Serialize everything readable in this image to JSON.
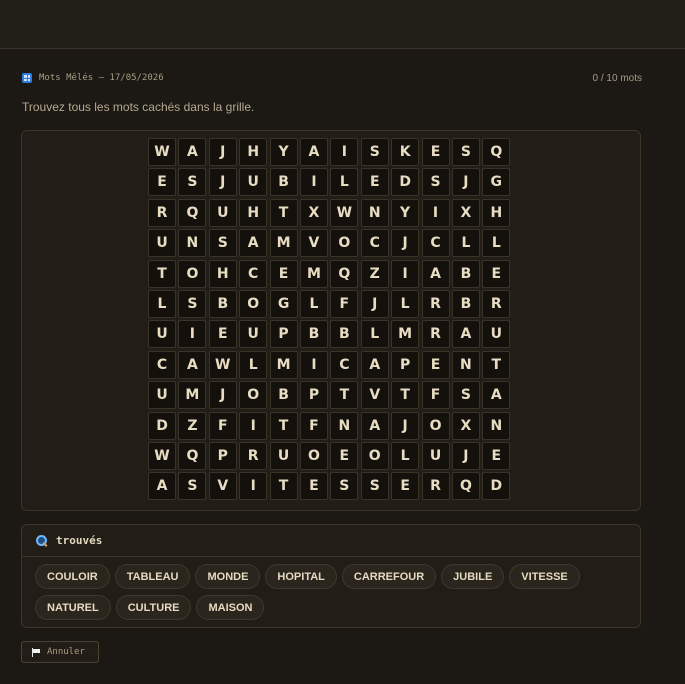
{
  "game": {
    "title": "Mots Mêlés — 17/05/2026",
    "score": "0 / 10 mots",
    "instruction": "Trouvez tous les mots cachés dans la grille."
  },
  "grid": [
    [
      "W",
      "A",
      "J",
      "H",
      "Y",
      "A",
      "I",
      "S",
      "K",
      "E",
      "S",
      "Q"
    ],
    [
      "E",
      "S",
      "J",
      "U",
      "B",
      "I",
      "L",
      "E",
      "D",
      "S",
      "J",
      "G"
    ],
    [
      "R",
      "Q",
      "U",
      "H",
      "T",
      "X",
      "W",
      "N",
      "Y",
      "I",
      "X",
      "H"
    ],
    [
      "U",
      "N",
      "S",
      "A",
      "M",
      "V",
      "O",
      "C",
      "J",
      "C",
      "L",
      "L"
    ],
    [
      "T",
      "O",
      "H",
      "C",
      "E",
      "M",
      "Q",
      "Z",
      "I",
      "A",
      "B",
      "E"
    ],
    [
      "L",
      "S",
      "B",
      "O",
      "G",
      "L",
      "F",
      "J",
      "L",
      "R",
      "B",
      "R"
    ],
    [
      "U",
      "I",
      "E",
      "U",
      "P",
      "B",
      "B",
      "L",
      "M",
      "R",
      "A",
      "U"
    ],
    [
      "C",
      "A",
      "W",
      "L",
      "M",
      "I",
      "C",
      "A",
      "P",
      "E",
      "N",
      "T"
    ],
    [
      "U",
      "M",
      "J",
      "O",
      "B",
      "P",
      "T",
      "V",
      "T",
      "F",
      "S",
      "A"
    ],
    [
      "D",
      "Z",
      "F",
      "I",
      "T",
      "F",
      "N",
      "A",
      "J",
      "O",
      "X",
      "N"
    ],
    [
      "W",
      "Q",
      "P",
      "R",
      "U",
      "O",
      "E",
      "O",
      "L",
      "U",
      "J",
      "E"
    ],
    [
      "A",
      "S",
      "V",
      "I",
      "T",
      "E",
      "S",
      "S",
      "E",
      "R",
      "Q",
      "D"
    ]
  ],
  "words_panel": {
    "icon": "magnifier-icon",
    "header": "trouvés",
    "words": [
      "COULOIR",
      "TABLEAU",
      "MONDE",
      "HOPITAL",
      "CARREFOUR",
      "JUBILE",
      "VITESSE",
      "NATUREL",
      "CULTURE",
      "MAISON"
    ]
  },
  "actions": {
    "cancel_icon": "flag-icon",
    "cancel_label": "Annuler"
  },
  "colors": {
    "background": "#1c1914",
    "panel": "#221e17",
    "cell": "#14110d",
    "text": "#e8dcc2",
    "accent_icon": "#2f7de1"
  }
}
